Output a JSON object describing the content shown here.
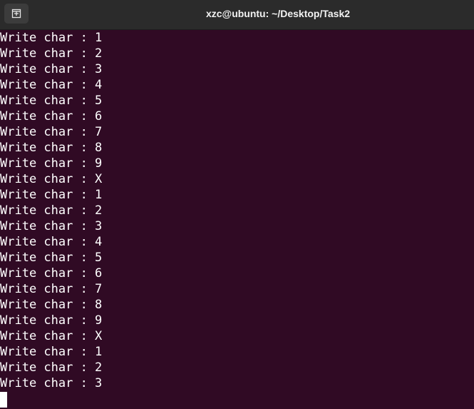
{
  "window": {
    "title": "xzc@ubuntu: ~/Desktop/Task2",
    "new_tab_icon": "new-tab-icon"
  },
  "terminal": {
    "lines": [
      "Write char : 1",
      "Write char : 2",
      "Write char : 3",
      "Write char : 4",
      "Write char : 5",
      "Write char : 6",
      "Write char : 7",
      "Write char : 8",
      "Write char : 9",
      "Write char : X",
      "Write char : 1",
      "Write char : 2",
      "Write char : 3",
      "Write char : 4",
      "Write char : 5",
      "Write char : 6",
      "Write char : 7",
      "Write char : 8",
      "Write char : 9",
      "Write char : X",
      "Write char : 1",
      "Write char : 2",
      "Write char : 3"
    ]
  },
  "colors": {
    "background": "#300a24",
    "titlebar": "#2b2b2b",
    "text": "#ffffff"
  }
}
